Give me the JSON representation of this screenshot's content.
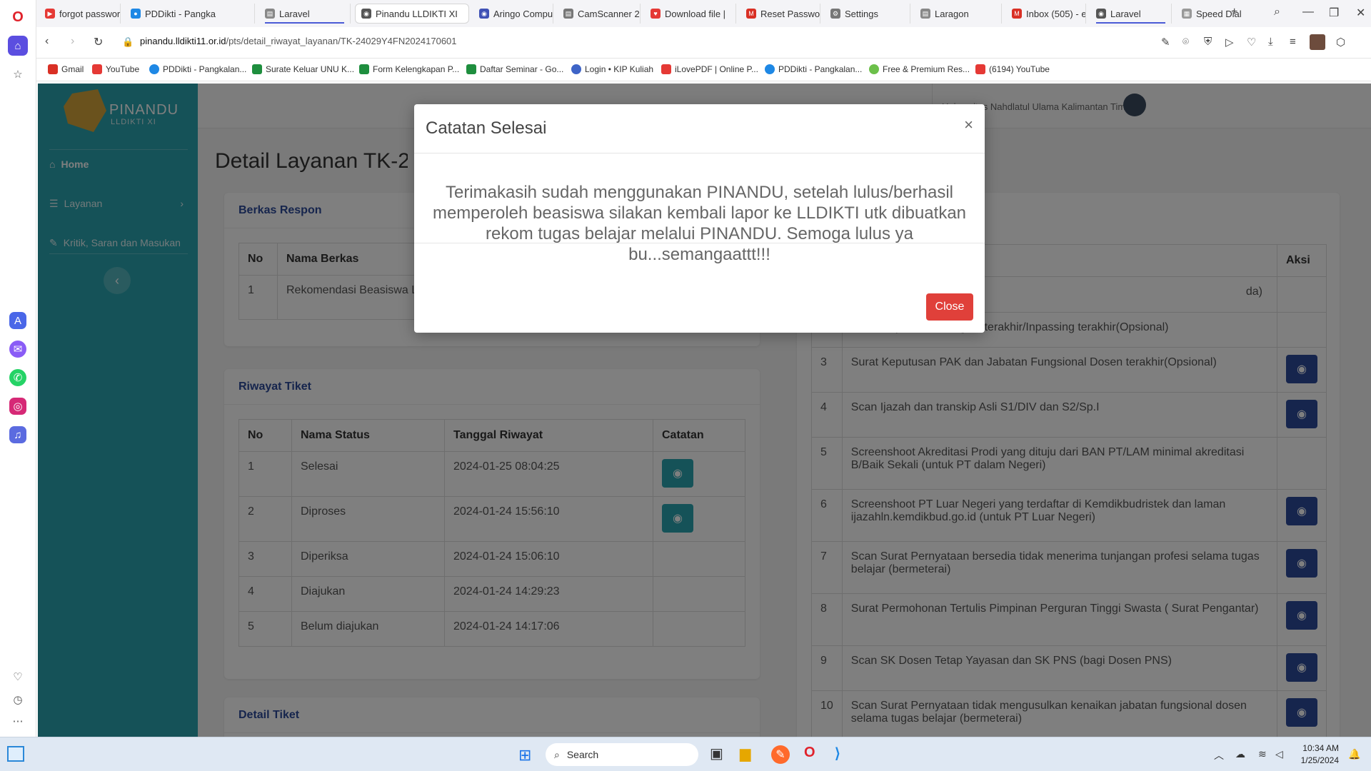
{
  "browser": {
    "tabs": [
      {
        "label": "forgot password",
        "color": "#e53935"
      },
      {
        "label": "PDDikti - Pangka",
        "color": "#1e88e5"
      },
      {
        "label": "Laravel",
        "color": "#666"
      },
      {
        "label": "Pinandu LLDIKTI XI",
        "color": "#444"
      },
      {
        "label": "Aringo Compute",
        "color": "#3f51b5"
      },
      {
        "label": "CamScanner 24-",
        "color": "#555"
      },
      {
        "label": "Download file |",
        "color": "#e53935"
      },
      {
        "label": "Reset Password",
        "color": "#d93025"
      },
      {
        "label": "Settings",
        "color": "#555"
      },
      {
        "label": "Laragon",
        "color": "#555"
      },
      {
        "label": "Inbox (505) - erd",
        "color": "#d93025"
      },
      {
        "label": "Laravel",
        "color": "#555"
      },
      {
        "label": "Speed Dial",
        "color": "#555"
      }
    ],
    "url_domain": "pinandu.lldikti11.or.id",
    "url_path": "/pts/detail_riwayat_layanan/TK-24029Y4FN2024170601",
    "bookmarks": [
      "Gmail",
      "YouTube",
      "PDDikti - Pangkalan...",
      "Surate Keluar UNU K...",
      "Form Kelengkapan P...",
      "Daftar Seminar - Go...",
      "Login • KIP Kuliah",
      "iLovePDF | Online P...",
      "PDDikti - Pangkalan...",
      "Free & Premium Res...",
      "(6194) YouTube"
    ]
  },
  "app": {
    "logo_name": "PINANDU",
    "logo_sub": "LLDIKTI XI",
    "menu": [
      {
        "label": "Home"
      },
      {
        "label": "Layanan"
      },
      {
        "label": "Kritik, Saran dan Masukan"
      }
    ],
    "university": "Universitas Nahdlatul Ulama Kalimantan Timur",
    "page_title": "Detail Layanan TK-240",
    "berkas_respon": {
      "title": "Berkas Respon",
      "headers": [
        "No",
        "Nama Berkas"
      ],
      "rows": [
        [
          "1",
          "Rekomendasi Beasiswa L"
        ]
      ]
    },
    "riwayat": {
      "title": "Riwayat Tiket",
      "headers": [
        "No",
        "Nama Status",
        "Tanggal Riwayat",
        "Catatan"
      ],
      "rows": [
        [
          "1",
          "Selesai",
          "2024-01-25 08:04:25"
        ],
        [
          "2",
          "Diproses",
          "2024-01-24 15:56:10"
        ],
        [
          "3",
          "Diperiksa",
          "2024-01-24 15:06:10"
        ],
        [
          "4",
          "Diajukan",
          "2024-01-24 14:29:23"
        ],
        [
          "5",
          "Belum diajukan",
          "2024-01-24 14:17:06"
        ]
      ]
    },
    "detail_tiket_title": "Detail Tiket",
    "berkas": {
      "header_aksi": "Aksi",
      "rows": [
        {
          "no": "",
          "name": "da)"
        },
        {
          "no": "2",
          "name": "Surat Keputusan Pangkat terakhir/Inpassing terakhir(Opsional)"
        },
        {
          "no": "3",
          "name": "Surat Keputusan PAK dan Jabatan Fungsional Dosen terakhir(Opsional)"
        },
        {
          "no": "4",
          "name": "Scan Ijazah dan transkip Asli S1/DIV dan S2/Sp.I"
        },
        {
          "no": "5",
          "name": "Screenshoot Akreditasi Prodi yang dituju dari BAN PT/LAM minimal akreditasi B/Baik Sekali (untuk PT dalam Negeri)"
        },
        {
          "no": "6",
          "name": "Screenshoot PT Luar Negeri yang terdaftar di Kemdikbudristek dan laman ijazahln.kemdikbud.go.id (untuk PT Luar Negeri)"
        },
        {
          "no": "7",
          "name": "Scan Surat Pernyataan bersedia tidak menerima tunjangan profesi selama tugas belajar (bermeterai)"
        },
        {
          "no": "8",
          "name": "Surat Permohonan Tertulis Pimpinan Perguran Tinggi Swasta ( Surat Pengantar)"
        },
        {
          "no": "9",
          "name": "Scan SK Dosen Tetap Yayasan dan SK PNS (bagi Dosen PNS)"
        },
        {
          "no": "10",
          "name": "Scan Surat Pernyataan tidak mengusulkan kenaikan jabatan fungsional dosen selama tugas belajar (bermeterai)"
        }
      ]
    }
  },
  "modal": {
    "title": "Catatan Selesai",
    "close_x": "×",
    "body": "Terimakasih sudah menggunakan PINANDU, setelah lulus/berhasil memperoleh beasiswa silakan kembali lapor ke LLDIKTI utk dibuatkan rekom tugas belajar melalui PINANDU. Semoga lulus ya bu...semangaattt!!!",
    "close_label": "Close"
  },
  "taskbar": {
    "search_placeholder": "Search",
    "time": "10:34 AM",
    "date": "1/25/2024"
  },
  "colors": {
    "teal": "#2aa5b0",
    "navy": "#2c4a9a",
    "danger": "#e0403a"
  }
}
